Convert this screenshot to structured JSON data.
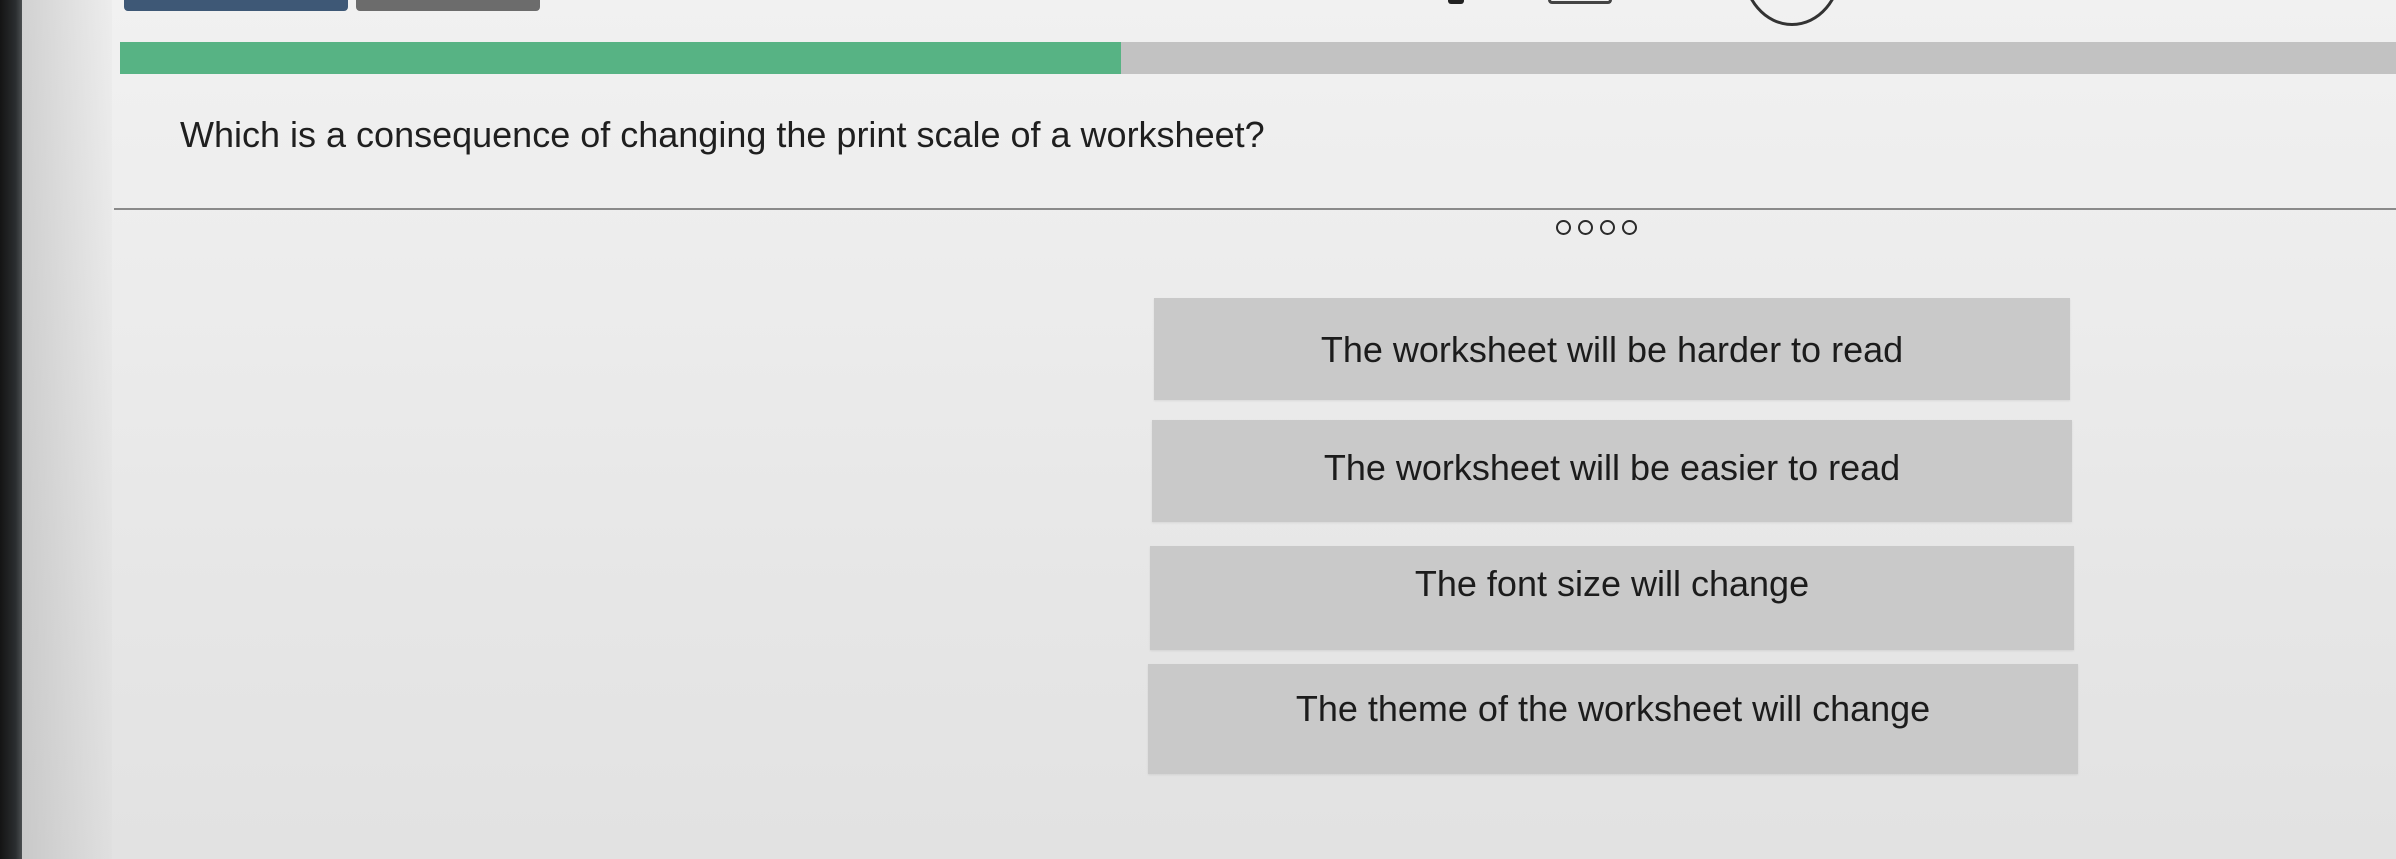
{
  "colors": {
    "progress_fill": "#57b384",
    "progress_track": "#c2c2c2",
    "answer_background": "#c9c9c9",
    "page_background": "#ececec"
  },
  "progress": {
    "fraction": 0.44
  },
  "step_indicator": {
    "total_steps": 4
  },
  "question": {
    "text": "Which is a consequence of changing the print scale of a worksheet?"
  },
  "answers": [
    {
      "label": "The worksheet will be harder to read"
    },
    {
      "label": "The worksheet will be easier to read"
    },
    {
      "label": "The font size will change"
    },
    {
      "label": "The theme of the worksheet will change"
    }
  ]
}
